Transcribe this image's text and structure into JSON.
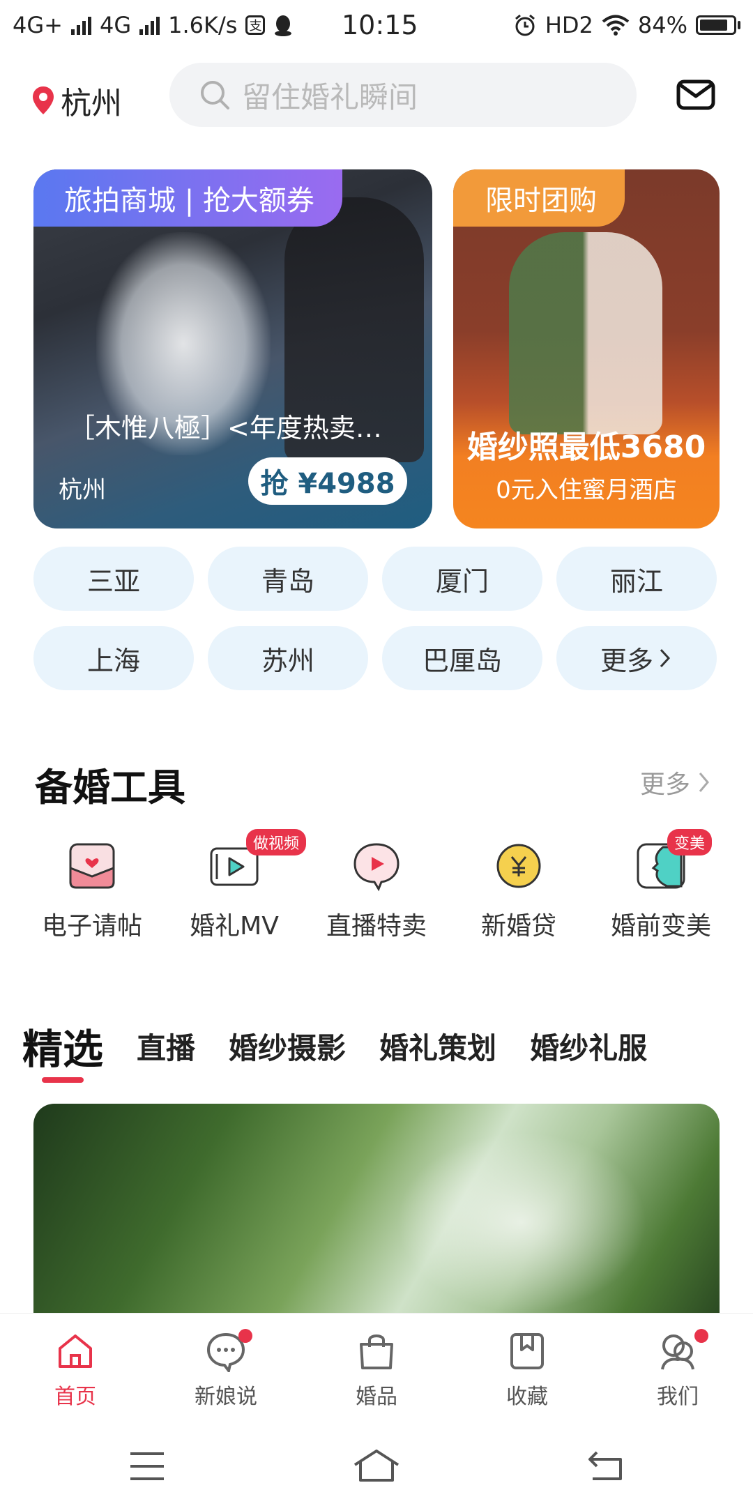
{
  "status_bar": {
    "net1": "4G+",
    "net2": "4G",
    "speed": "1.6K/s",
    "pay_icon_text": "支",
    "time": "10:15",
    "hd": "HD2",
    "battery": "84%",
    "battery_level": 0.84
  },
  "header": {
    "city": "杭州",
    "search_placeholder": "留住婚礼瞬间"
  },
  "banners": {
    "left": {
      "tag": "旅拍商城 | 抢大额券",
      "title": "［木惟八極］<年度热卖…",
      "city": "杭州",
      "price": "抢 ¥4988"
    },
    "right": {
      "tag": "限时团购",
      "headline": "婚纱照最低3680",
      "subline": "0元入住蜜月酒店"
    }
  },
  "cities": [
    "三亚",
    "青岛",
    "厦门",
    "丽江",
    "上海",
    "苏州",
    "巴厘岛",
    "更多"
  ],
  "tools_section": {
    "title": "备婚工具",
    "more": "更多",
    "items": [
      {
        "label": "电子请帖",
        "icon": "invitation-icon",
        "badge": ""
      },
      {
        "label": "婚礼MV",
        "icon": "video-play-icon",
        "badge": "做视频"
      },
      {
        "label": "直播特卖",
        "icon": "live-chat-icon",
        "badge": ""
      },
      {
        "label": "新婚贷",
        "icon": "yuan-coin-icon",
        "badge": ""
      },
      {
        "label": "婚前变美",
        "icon": "beauty-face-icon",
        "badge": "变美"
      }
    ]
  },
  "feed_tabs": [
    "精选",
    "直播",
    "婚纱摄影",
    "婚礼策划",
    "婚纱礼服"
  ],
  "bottom_nav": [
    {
      "label": "首页",
      "icon": "home-icon",
      "dot": false
    },
    {
      "label": "新娘说",
      "icon": "chat-bubble-icon",
      "dot": true
    },
    {
      "label": "婚品",
      "icon": "shopping-bag-icon",
      "dot": false
    },
    {
      "label": "收藏",
      "icon": "bookmark-icon",
      "dot": false
    },
    {
      "label": "我们",
      "icon": "people-icon",
      "dot": true
    }
  ],
  "colors": {
    "accent": "#e8334a",
    "chip_bg": "#e9f4fc",
    "left_tag": "#7a70f0",
    "right_tag": "#f29a3a"
  }
}
